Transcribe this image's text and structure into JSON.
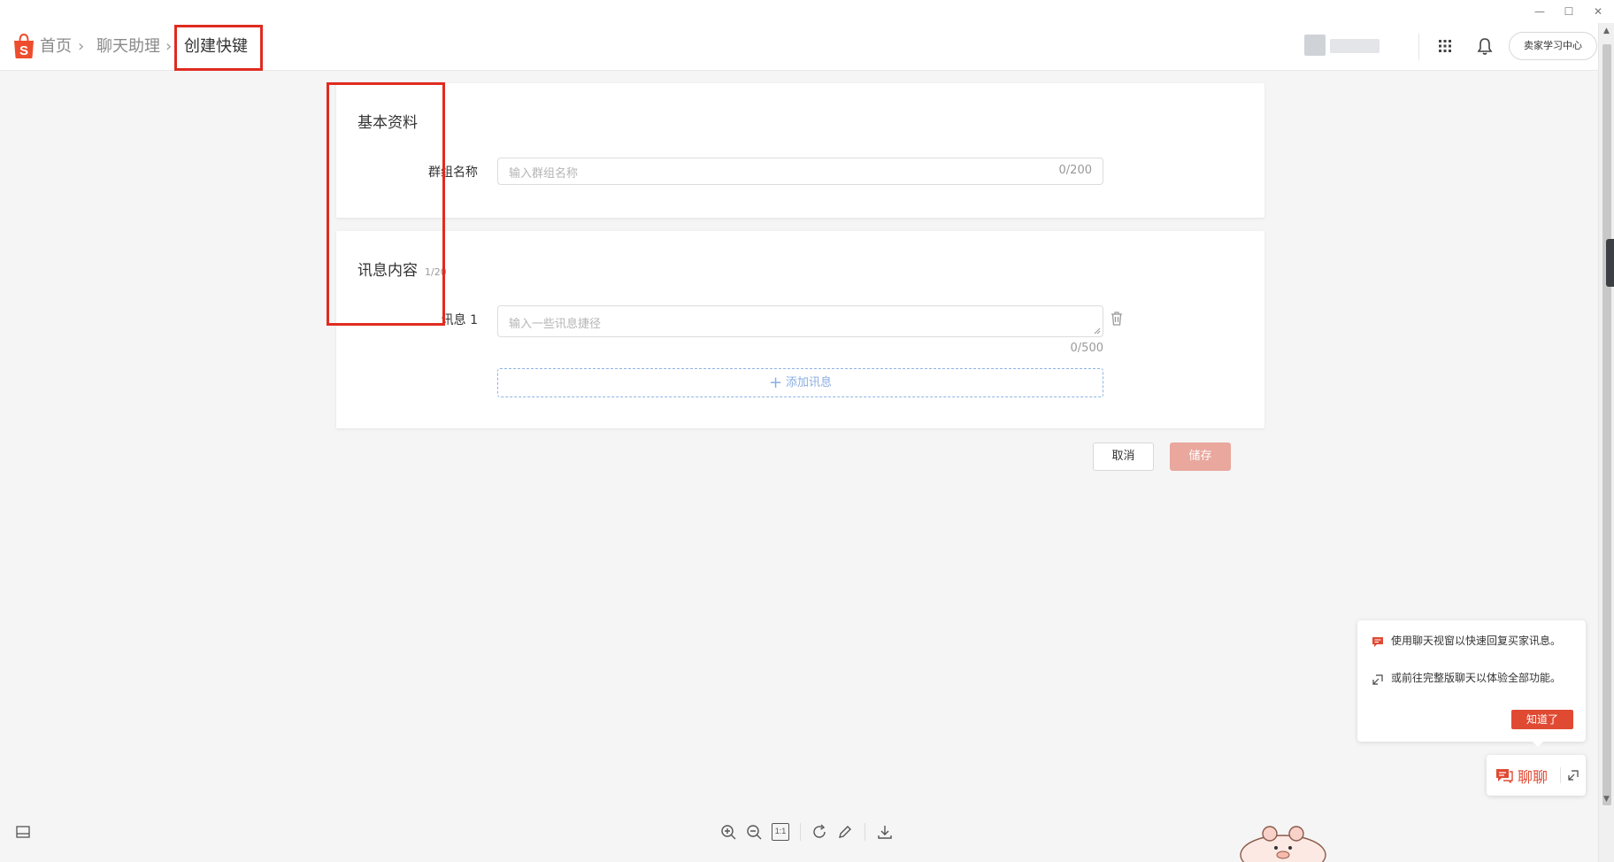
{
  "window": {
    "minimize": "—",
    "maximize": "☐",
    "close": "✕"
  },
  "header": {
    "breadcrumb": [
      "首页",
      "聊天助理",
      "创建快键"
    ],
    "learn_center_label": "卖家学习中心"
  },
  "basic_info": {
    "title": "基本资料",
    "group_name_label": "群组名称",
    "group_name_placeholder": "输入群组名称",
    "group_name_count": "0/200"
  },
  "message_content": {
    "title": "讯息内容",
    "count": "1/20",
    "message_label": "讯息 1",
    "message_placeholder": "输入一些讯息捷径",
    "message_count": "0/500",
    "add_message_label": "添加讯息"
  },
  "actions": {
    "cancel_label": "取消",
    "save_label": "储存"
  },
  "chat_tooltip": {
    "line1": "使用聊天视窗以快速回复买家讯息。",
    "line2": "或前往完整版聊天以体验全部功能。",
    "ok_label": "知道了"
  },
  "chat_button": {
    "label": "聊聊"
  },
  "viewer_toolbar": {
    "actual_size_label": "1:1"
  },
  "colors": {
    "brand": "#ee4d2d",
    "highlight": "#e02b20",
    "save_disabled": "#e9a79d",
    "dashed_link": "#8aaee0"
  }
}
